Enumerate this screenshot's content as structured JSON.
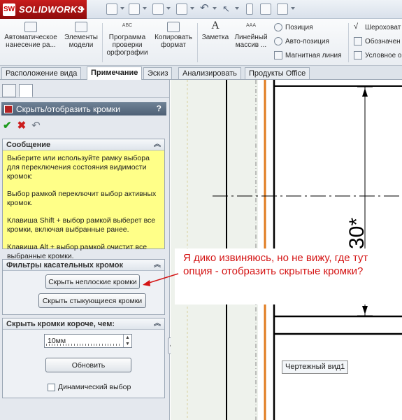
{
  "app": {
    "brand": "SOLIDWORKS",
    "logo_mark": "SW"
  },
  "ribbon": {
    "buttons": [
      {
        "label": "Автоматическое нанесение ра...",
        "icon": "auto-dimension-icon"
      },
      {
        "label": "Элементы модели",
        "icon": "model-items-icon"
      },
      {
        "label": "Программа проверки орфографии",
        "icon": "spell-check-icon"
      },
      {
        "label": "Копировать формат",
        "icon": "format-painter-icon"
      },
      {
        "label": "Заметка",
        "icon": "note-icon"
      },
      {
        "label": "Линейный массив ...",
        "icon": "linear-pattern-icon"
      }
    ],
    "small_buttons": [
      {
        "label": "Позиция",
        "icon": "balloon-icon"
      },
      {
        "label": "Авто-позиция",
        "icon": "auto-balloon-icon"
      },
      {
        "label": "Магнитная линия",
        "icon": "magnetic-line-icon"
      },
      {
        "label": "Шероховат",
        "icon": "surface-finish-icon"
      },
      {
        "label": "Обозначен",
        "icon": "weld-symbol-icon"
      },
      {
        "label": "Условное о",
        "icon": "hole-callout-icon"
      }
    ],
    "abc_glyph": "ABC",
    "note_glyph": "A",
    "pattern_glyph": "AAA"
  },
  "tabs": [
    {
      "label": "Расположение вида",
      "active": false
    },
    {
      "label": "Примечание",
      "active": true
    },
    {
      "label": "Эскиз",
      "active": false
    },
    {
      "label": "Анализировать",
      "active": false
    },
    {
      "label": "Продукты Office",
      "active": false
    }
  ],
  "property_manager": {
    "title": "Скрыть/отобразить кромки",
    "help": "?",
    "ok": "✔",
    "cancel": "✖",
    "undo": "↶",
    "message": {
      "header": "Сообщение",
      "paragraphs": [
        "Выберите или используйте рамку выбора для переключения состояния видимости кромок:",
        "Выбор рамкой переключит выбор активных кромок.",
        "Клавиша Shift + выбор рамкой выберет все кромки, включая выбранные ранее.",
        "Клавиша Alt + выбор рамкой очистит все выбранные кромки."
      ]
    },
    "filters": {
      "header": "Фильтры касательных кромок",
      "hide_nonplanar": "Скрыть неплоские кромки",
      "hide_joined": "Скрыть стыкующиеся кромки"
    },
    "shorter": {
      "header": "Скрыть кромки короче, чем:",
      "value": "10мм",
      "update": "Обновить",
      "dynamic": "Динамический выбор"
    }
  },
  "annotation": {
    "text": "Я дико извиняюсь, но не вижу, где тут опция - отобразить скрытые кромки?"
  },
  "drawing": {
    "dimension": "30*",
    "view_label": "Чертежный вид1"
  }
}
